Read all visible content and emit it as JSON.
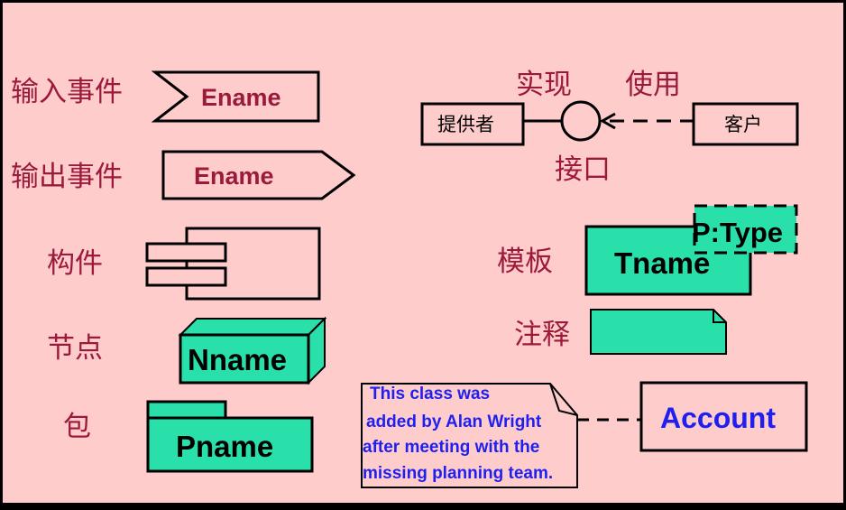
{
  "colors": {
    "background": "#ffcccc",
    "label_text": "#9b1a3c",
    "fill_green": "#2ae0aa",
    "note_text": "#1f1ff0",
    "stroke": "#000000"
  },
  "labels": {
    "input_event": "输入事件",
    "output_event": "输出事件",
    "component": "构件",
    "node": "节点",
    "package": "包",
    "realize": "实现",
    "use": "使用",
    "interface": "接口",
    "template": "模板",
    "note": "注释"
  },
  "shapes": {
    "input_event_name": "Ename",
    "output_event_name": "Ename",
    "node_name": "Nname",
    "package_name": "Pname",
    "template_name": "Tname",
    "template_param": "P:Type",
    "provider": "提供者",
    "client": "客户",
    "account": "Account",
    "note_lines": [
      "This class was",
      "added by Alan Wright",
      "after meeting with the",
      "missing planning team."
    ]
  }
}
